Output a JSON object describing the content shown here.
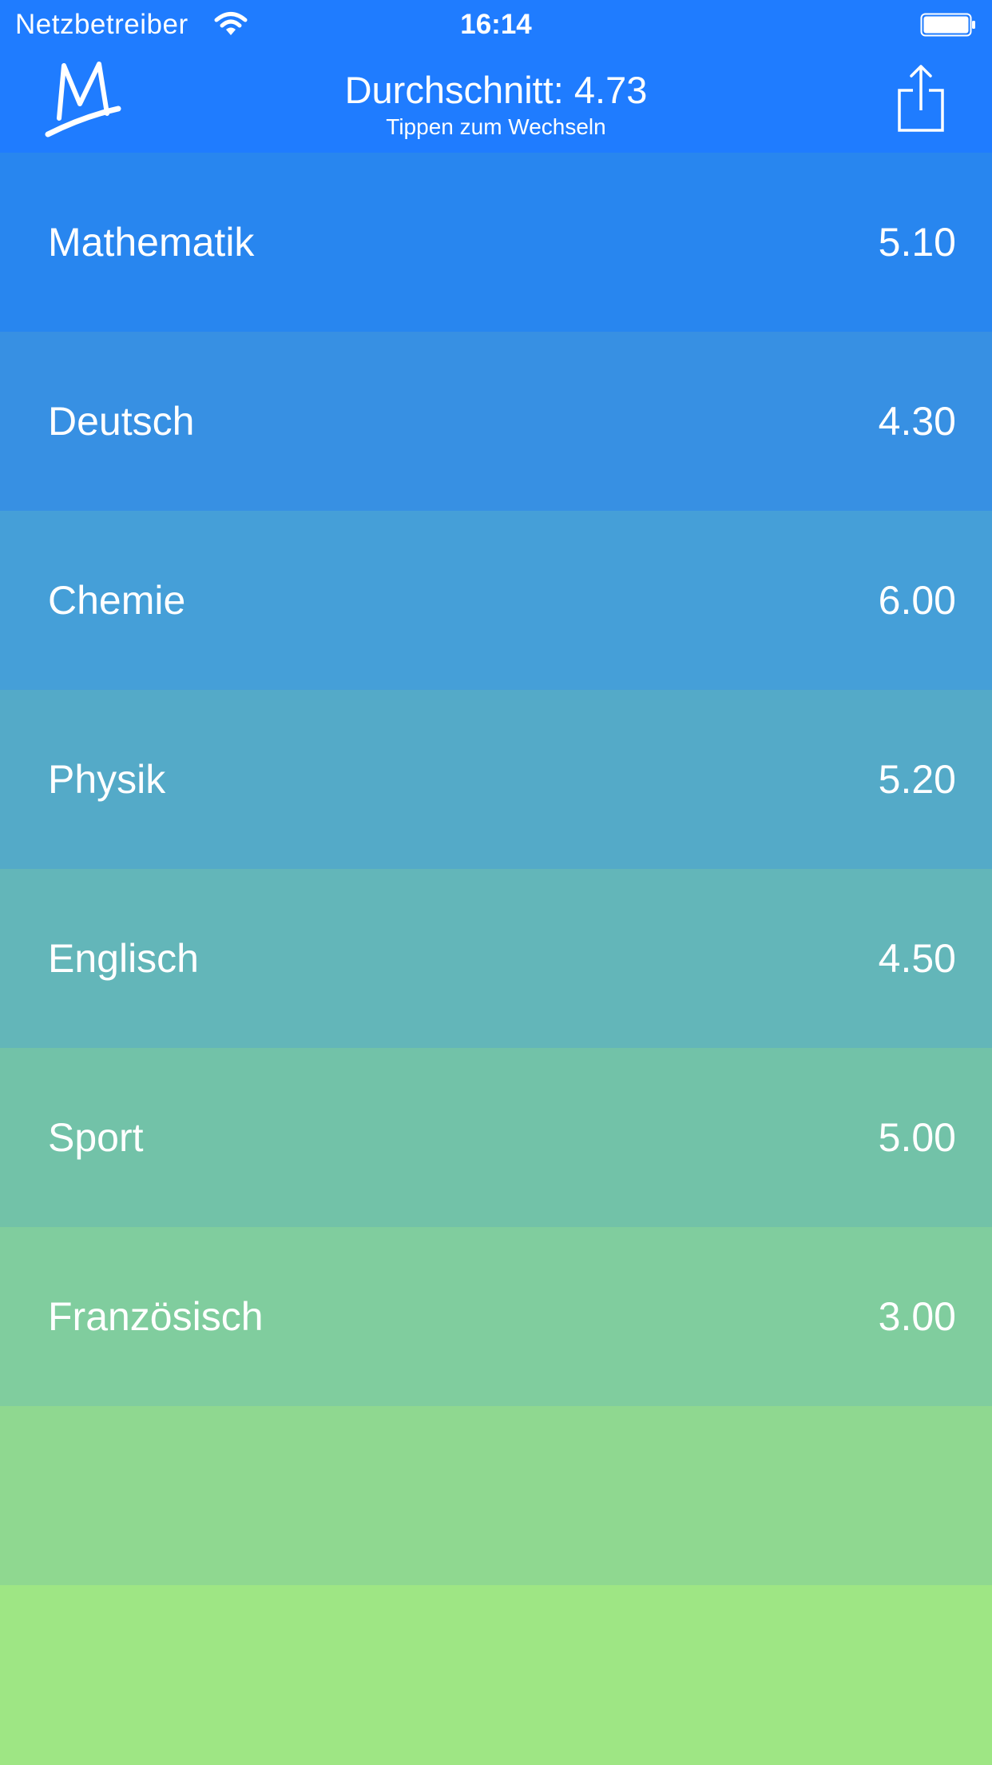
{
  "status_bar": {
    "carrier": "Netzbetreiber",
    "time": "16:14",
    "wifi_icon": "wifi-icon",
    "battery_icon": "battery-icon"
  },
  "nav": {
    "logo_icon": "m-logo-icon",
    "title": "Durchschnitt: 4.73",
    "subtitle": "Tippen zum Wechseln",
    "share_icon": "share-icon",
    "header_color": "#1f7cff"
  },
  "subjects": [
    {
      "name": "Mathematik",
      "grade": "5.10",
      "color": "#2886ef"
    },
    {
      "name": "Deutsch",
      "grade": "4.30",
      "color": "#3790e3"
    },
    {
      "name": "Chemie",
      "grade": "6.00",
      "color": "#459fd8"
    },
    {
      "name": "Physik",
      "grade": "5.20",
      "color": "#54aac8"
    },
    {
      "name": "Englisch",
      "grade": "4.50",
      "color": "#63b6b9"
    },
    {
      "name": "Sport",
      "grade": "5.00",
      "color": "#72c2a8"
    },
    {
      "name": "Französisch",
      "grade": "3.00",
      "color": "#80cd9e"
    }
  ],
  "empty_rows": [
    {
      "color": "#8fd890"
    },
    {
      "color": "#9ee684"
    }
  ]
}
